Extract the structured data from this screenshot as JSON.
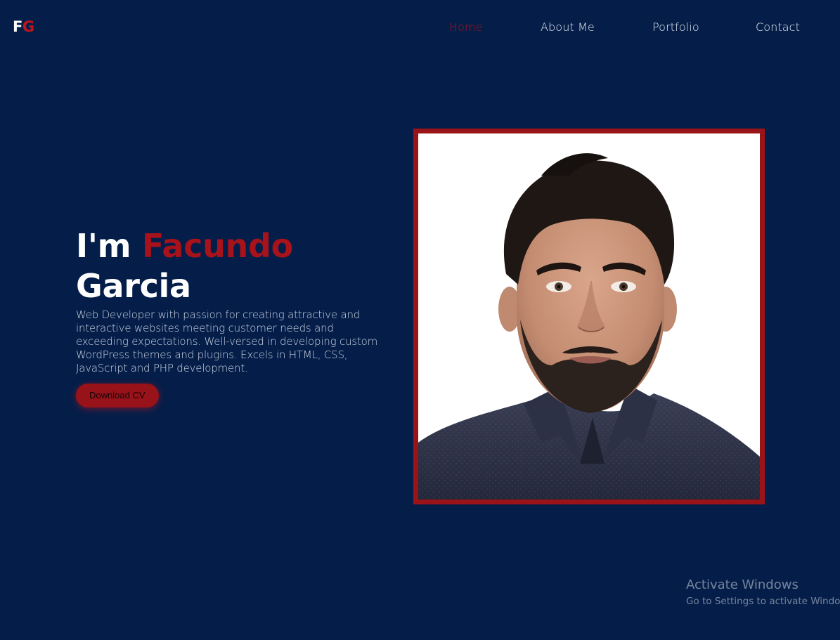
{
  "logo": {
    "first": "F",
    "second": "G"
  },
  "nav": {
    "items": [
      "Home",
      "About Me",
      "Portfolio",
      "Contact"
    ],
    "active": "Home"
  },
  "hero": {
    "intro": "I'm",
    "first_name": "Facundo",
    "last_name": "Garcia",
    "description": "Web Developer with passion for creating attractive and interactive websites meeting customer needs and exceeding expectations. Well-versed in developing custom WordPress themes and plugins. Excels in HTML, CSS, JavaScript and PHP development.",
    "cta_label": "Download CV"
  },
  "portrait": {
    "alt": ""
  },
  "watermark": {
    "title": "Activate Windows",
    "subtitle": "Go to Settings to activate Windows."
  },
  "colors": {
    "background": "#041e49",
    "accent": "#a8121b",
    "frame": "#9a1318",
    "text": "#ffffff"
  }
}
